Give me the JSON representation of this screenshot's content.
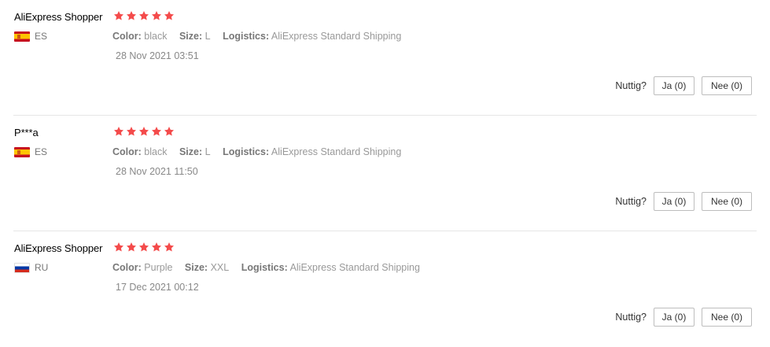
{
  "theme": {
    "star_color": "#f44b4b"
  },
  "labels": {
    "color": "Color:",
    "size": "Size:",
    "logistics": "Logistics:",
    "helpful_question": "Nuttig?"
  },
  "reviews": [
    {
      "user": "AliExpress Shopper",
      "rating": 5,
      "country": "ES",
      "flag": "spain-flag-icon",
      "color": "black",
      "size": "L",
      "logistics": "AliExpress Standard Shipping",
      "date": "28 Nov 2021 03:51",
      "yes_label": "Ja (0)",
      "no_label": "Nee (0)"
    },
    {
      "user": "P***a",
      "rating": 5,
      "country": "ES",
      "flag": "spain-flag-icon",
      "color": "black",
      "size": "L",
      "logistics": "AliExpress Standard Shipping",
      "date": "28 Nov 2021 11:50",
      "yes_label": "Ja (0)",
      "no_label": "Nee (0)"
    },
    {
      "user": "AliExpress Shopper",
      "rating": 5,
      "country": "RU",
      "flag": "russia-flag-icon",
      "color": "Purple",
      "size": "XXL",
      "logistics": "AliExpress Standard Shipping",
      "date": "17 Dec 2021 00:12",
      "yes_label": "Ja (0)",
      "no_label": "Nee (0)"
    }
  ]
}
